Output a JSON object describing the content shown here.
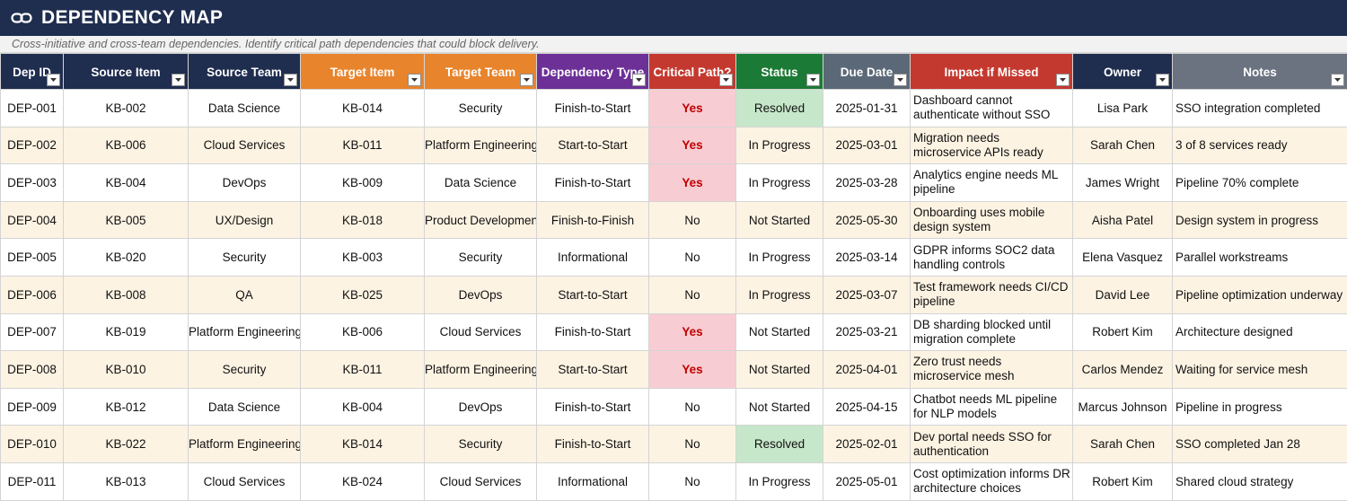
{
  "sheet": {
    "title": "DEPENDENCY MAP",
    "subtitle": "Cross-initiative and cross-team dependencies. Identify critical path dependencies that could block delivery.",
    "title_icon": "link-icon"
  },
  "colors": {
    "title_bg": "#1f2d4f",
    "header_navy": "#1f2d4f",
    "header_orange": "#e8842c",
    "header_purple": "#6c3097",
    "header_red": "#c4392f",
    "header_green": "#1b7a35",
    "header_slate": "#5b6877",
    "row_alt": "#fdf3e3",
    "critical_yes_bg": "#f8ccd3",
    "critical_yes_text": "#c00000",
    "resolved_bg": "#c6e7c9"
  },
  "columns": [
    {
      "label": "Dep ID"
    },
    {
      "label": "Source Item"
    },
    {
      "label": "Source Team"
    },
    {
      "label": "Target Item"
    },
    {
      "label": "Target Team"
    },
    {
      "label": "Dependency Type"
    },
    {
      "label": "Critical Path?"
    },
    {
      "label": "Status"
    },
    {
      "label": "Due Date"
    },
    {
      "label": "Impact if Missed"
    },
    {
      "label": "Owner"
    },
    {
      "label": "Notes"
    }
  ],
  "rows": [
    {
      "dep_id": "DEP-001",
      "source_item": "KB-002",
      "source_team": "Data Science",
      "target_item": "KB-014",
      "target_team": "Security",
      "dep_type": "Finish-to-Start",
      "critical": "Yes",
      "status": "Resolved",
      "due": "2025-01-31",
      "impact": "Dashboard cannot authenticate without SSO",
      "owner": "Lisa Park",
      "notes": "SSO integration completed"
    },
    {
      "dep_id": "DEP-002",
      "source_item": "KB-006",
      "source_team": "Cloud Services",
      "target_item": "KB-011",
      "target_team": "Platform Engineering",
      "dep_type": "Start-to-Start",
      "critical": "Yes",
      "status": "In Progress",
      "due": "2025-03-01",
      "impact": "Migration needs microservice APIs ready",
      "owner": "Sarah Chen",
      "notes": "3 of 8 services ready"
    },
    {
      "dep_id": "DEP-003",
      "source_item": "KB-004",
      "source_team": "DevOps",
      "target_item": "KB-009",
      "target_team": "Data Science",
      "dep_type": "Finish-to-Start",
      "critical": "Yes",
      "status": "In Progress",
      "due": "2025-03-28",
      "impact": "Analytics engine needs ML pipeline",
      "owner": "James Wright",
      "notes": "Pipeline 70% complete"
    },
    {
      "dep_id": "DEP-004",
      "source_item": "KB-005",
      "source_team": "UX/Design",
      "target_item": "KB-018",
      "target_team": "Product Development",
      "dep_type": "Finish-to-Finish",
      "critical": "No",
      "status": "Not Started",
      "due": "2025-05-30",
      "impact": "Onboarding uses mobile design system",
      "owner": "Aisha Patel",
      "notes": "Design system in progress"
    },
    {
      "dep_id": "DEP-005",
      "source_item": "KB-020",
      "source_team": "Security",
      "target_item": "KB-003",
      "target_team": "Security",
      "dep_type": "Informational",
      "critical": "No",
      "status": "In Progress",
      "due": "2025-03-14",
      "impact": "GDPR informs SOC2 data handling controls",
      "owner": "Elena Vasquez",
      "notes": "Parallel workstreams"
    },
    {
      "dep_id": "DEP-006",
      "source_item": "KB-008",
      "source_team": "QA",
      "target_item": "KB-025",
      "target_team": "DevOps",
      "dep_type": "Start-to-Start",
      "critical": "No",
      "status": "In Progress",
      "due": "2025-03-07",
      "impact": "Test framework needs CI/CD pipeline",
      "owner": "David Lee",
      "notes": "Pipeline optimization underway"
    },
    {
      "dep_id": "DEP-007",
      "source_item": "KB-019",
      "source_team": "Platform Engineering",
      "target_item": "KB-006",
      "target_team": "Cloud Services",
      "dep_type": "Finish-to-Start",
      "critical": "Yes",
      "status": "Not Started",
      "due": "2025-03-21",
      "impact": "DB sharding blocked until migration complete",
      "owner": "Robert Kim",
      "notes": "Architecture designed"
    },
    {
      "dep_id": "DEP-008",
      "source_item": "KB-010",
      "source_team": "Security",
      "target_item": "KB-011",
      "target_team": "Platform Engineering",
      "dep_type": "Start-to-Start",
      "critical": "Yes",
      "status": "Not Started",
      "due": "2025-04-01",
      "impact": "Zero trust needs microservice mesh",
      "owner": "Carlos Mendez",
      "notes": "Waiting for service mesh"
    },
    {
      "dep_id": "DEP-009",
      "source_item": "KB-012",
      "source_team": "Data Science",
      "target_item": "KB-004",
      "target_team": "DevOps",
      "dep_type": "Finish-to-Start",
      "critical": "No",
      "status": "Not Started",
      "due": "2025-04-15",
      "impact": "Chatbot needs ML pipeline for NLP models",
      "owner": "Marcus Johnson",
      "notes": "Pipeline in progress"
    },
    {
      "dep_id": "DEP-010",
      "source_item": "KB-022",
      "source_team": "Platform Engineering",
      "target_item": "KB-014",
      "target_team": "Security",
      "dep_type": "Finish-to-Start",
      "critical": "No",
      "status": "Resolved",
      "due": "2025-02-01",
      "impact": "Dev portal needs SSO for authentication",
      "owner": "Sarah Chen",
      "notes": "SSO completed Jan 28"
    },
    {
      "dep_id": "DEP-011",
      "source_item": "KB-013",
      "source_team": "Cloud Services",
      "target_item": "KB-024",
      "target_team": "Cloud Services",
      "dep_type": "Informational",
      "critical": "No",
      "status": "In Progress",
      "due": "2025-05-01",
      "impact": "Cost optimization informs DR architecture choices",
      "owner": "Robert Kim",
      "notes": "Shared cloud strategy"
    }
  ]
}
